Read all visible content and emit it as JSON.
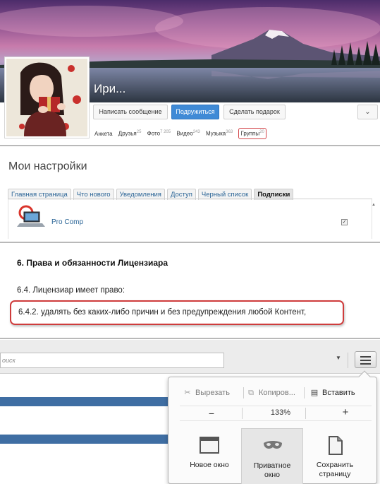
{
  "profile": {
    "name": "Ири...",
    "buttons": {
      "message": "Написать сообщение",
      "friend": "Подружиться",
      "gift": "Сделать подарок"
    },
    "more_icon": "chevron-down-icon",
    "tabs": [
      {
        "label": "Анкета",
        "count": ""
      },
      {
        "label": "Друзья",
        "count": "25"
      },
      {
        "label": "Фото",
        "count": "7 205"
      },
      {
        "label": "Видео",
        "count": "243"
      },
      {
        "label": "Музыка",
        "count": "363"
      },
      {
        "label": "Группы",
        "count": "20"
      }
    ],
    "highlight_color": "#d3464a"
  },
  "settings": {
    "title": "Мои настройки",
    "tabs": [
      "Главная страница",
      "Что нового",
      "Уведомления",
      "Доступ",
      "Черный список",
      "Подписки"
    ],
    "active_tab": "Подписки",
    "subscription": {
      "name": "Pro Comp",
      "checked": true,
      "check_glyph": "✓"
    }
  },
  "license": {
    "heading": "6. Права и обязанности Лицензиара",
    "p1": "6.4. Лицензиар имеет право:",
    "p2": "6.4.2. удалять без каких-либо причин и без предупреждения любой Контент,"
  },
  "browser": {
    "search_placeholder": "оиск",
    "dropdown_glyph": "▼",
    "menu": {
      "cut": "Вырезать",
      "copy": "Копиров...",
      "paste": "Вставить",
      "zoom_minus": "−",
      "zoom_value": "133%",
      "zoom_plus": "+",
      "new_window": "Новое окно",
      "private_window_1": "Приватное",
      "private_window_2": "окно",
      "save_page_1": "Сохранить",
      "save_page_2": "страницу"
    },
    "accent": "#3f6ea3"
  }
}
